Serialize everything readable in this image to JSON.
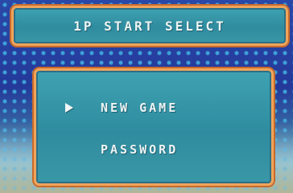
{
  "title": "1P START SELECT",
  "menu": {
    "items": [
      {
        "label": "NEW GAME",
        "selected": true
      },
      {
        "label": "PASSWORD",
        "selected": false
      }
    ]
  },
  "colors": {
    "panel_fill": "#3ea2b2",
    "panel_border": "#f0a45a",
    "text": "#eef4f4",
    "background": "#2a48a8"
  },
  "icons": {
    "cursor": "triangle-right-cursor-icon"
  }
}
